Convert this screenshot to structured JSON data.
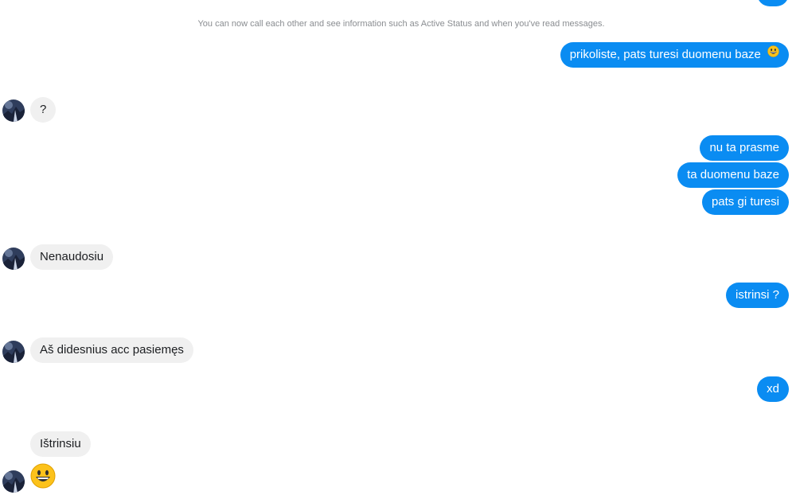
{
  "conversation": {
    "system_note": "You can now call each other and see information such as Active Status and when you've read messages.",
    "messages": [
      {
        "from": "me",
        "text": "prikoliste, pats turesi duomenu baze",
        "emoji": "grinning-face-icon"
      },
      {
        "from": "contact",
        "text": "?"
      },
      {
        "from": "me",
        "text": "nu ta prasme"
      },
      {
        "from": "me",
        "text": "ta duomenu baze"
      },
      {
        "from": "me",
        "text": "pats gi turesi"
      },
      {
        "from": "contact",
        "text": "Nenaudosiu"
      },
      {
        "from": "me",
        "text": "istrinsi ?"
      },
      {
        "from": "contact",
        "text": "Aš didesnius acc pasiemęs"
      },
      {
        "from": "me",
        "text": "xd"
      },
      {
        "from": "contact",
        "text": "Ištrinsiu"
      },
      {
        "from": "contact",
        "emoji": "grinning-face-icon"
      }
    ]
  },
  "colors": {
    "outgoing_bubble": "#0a8cf2",
    "incoming_bubble": "#f0f0f0",
    "system_text": "#8a8d91",
    "avatar_bg": "#2f3d5c"
  }
}
